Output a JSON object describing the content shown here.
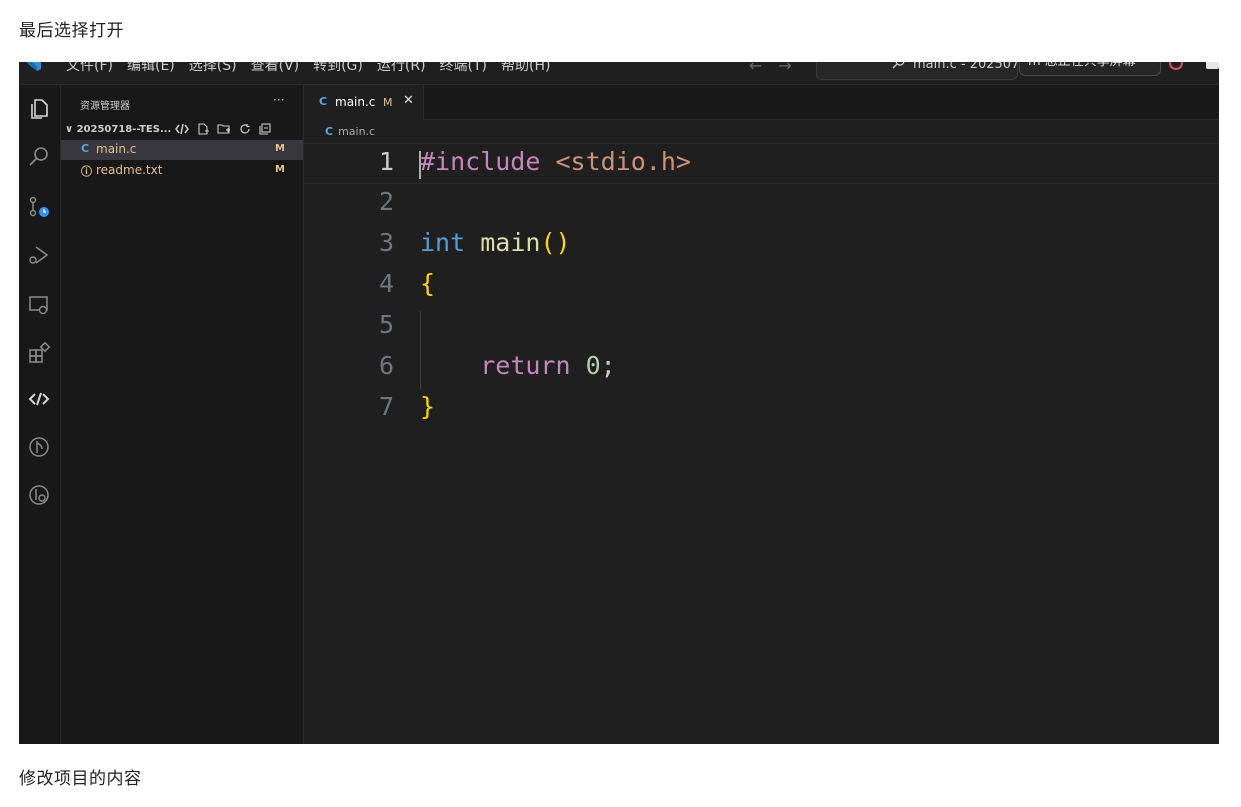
{
  "captions": {
    "top": "最后选择打开",
    "bottom": "修改项目的内容"
  },
  "titlebar": {
    "menu": [
      "文件(F)",
      "编辑(E)",
      "选择(S)",
      "查看(V)",
      "转到(G)",
      "运行(R)",
      "终端(T)",
      "帮助(H)"
    ],
    "nav": [
      "←",
      "→"
    ],
    "command_center": "main.c - 202507",
    "live_share": "m 您正在共享屏幕"
  },
  "colors": {
    "background": "#1f1f1f",
    "sidebar": "#181818",
    "accent": "#5aa7e6",
    "modified": "#e2c08d"
  },
  "activity_bar": [
    "explorer-icon",
    "search-icon",
    "source-control-icon",
    "run-debug-icon",
    "remote-explorer-icon",
    "extensions-icon",
    "live-share-icon",
    "git-graph-icon",
    "gitlens-icon"
  ],
  "sidebar": {
    "title": "资源管理器",
    "more": "···",
    "folder": "∨ 20250718--TES...",
    "files": [
      {
        "icon": "C",
        "name": "main.c",
        "status": "M",
        "active": true,
        "icon_color": "#5aa7e6",
        "name_color": "#e2c08d"
      },
      {
        "icon": "ⓘ",
        "name": "readme.txt",
        "status": "M",
        "active": false,
        "icon_color": "#e2c08d",
        "name_color": "#e2c08d"
      }
    ]
  },
  "editor": {
    "tab": {
      "icon": "C",
      "label": "main.c",
      "modified": "M",
      "close": "✕"
    },
    "breadcrumb": {
      "icon": "C",
      "label": "main.c"
    },
    "lines": [
      {
        "n": "1",
        "tokens": [
          [
            "#include",
            "tok-kw-pp"
          ],
          [
            " ",
            ""
          ],
          [
            "<stdio.h>",
            "tok-str"
          ]
        ]
      },
      {
        "n": "2",
        "tokens": []
      },
      {
        "n": "3",
        "tokens": [
          [
            "int",
            "tok-type"
          ],
          [
            " ",
            ""
          ],
          [
            "main",
            "tok-fn"
          ],
          [
            "()",
            "tok-brace"
          ]
        ]
      },
      {
        "n": "4",
        "tokens": [
          [
            "{",
            "tok-brace"
          ]
        ]
      },
      {
        "n": "5",
        "tokens": []
      },
      {
        "n": "6",
        "tokens": [
          [
            "    ",
            ""
          ],
          [
            "return",
            "tok-ctrl"
          ],
          [
            " ",
            ""
          ],
          [
            "0",
            "tok-num"
          ],
          [
            ";",
            "tok-punct"
          ]
        ]
      },
      {
        "n": "7",
        "tokens": [
          [
            "}",
            "tok-brace"
          ]
        ]
      }
    ]
  }
}
